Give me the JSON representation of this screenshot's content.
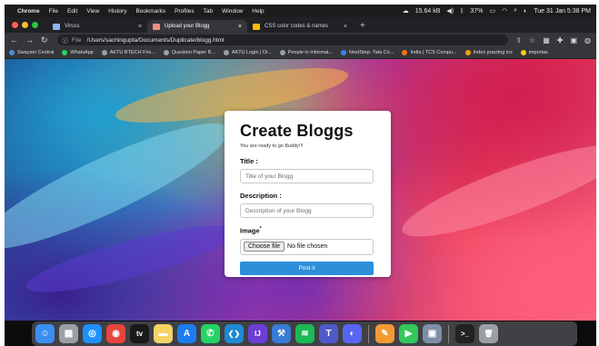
{
  "menubar": {
    "app": "Chrome",
    "menus": [
      "File",
      "Edit",
      "View",
      "History",
      "Bookmarks",
      "Profiles",
      "Tab",
      "Window",
      "Help"
    ],
    "clock": "Tue 31 Jan  5:38 PM",
    "speed": "15.64 kB",
    "battery": "37%"
  },
  "tabs": [
    {
      "title": "Viruss",
      "color": "#8ab4f8"
    },
    {
      "title": "Upload your Blogg",
      "color": "#f28b82"
    },
    {
      "title": "CSS color codes & names",
      "color": "#fbbc04"
    }
  ],
  "addressbar": {
    "scheme_label": "File",
    "url": "/Users/sachingupta/Documents/Duplicate/blogg.html"
  },
  "bookmarks": [
    {
      "label": "Swayam Central",
      "color": "#4a90d9"
    },
    {
      "label": "WhatsApp",
      "color": "#25d366"
    },
    {
      "label": "AKTU BTECH Firs...",
      "color": "#9aa0a6"
    },
    {
      "label": "Question Paper B...",
      "color": "#9aa0a6"
    },
    {
      "label": "AKTU Login | Di...",
      "color": "#9aa0a6"
    },
    {
      "label": "People in Informat...",
      "color": "#9aa0a6"
    },
    {
      "label": "NextStep- Tata Co...",
      "color": "#3b82f6"
    },
    {
      "label": "India | TCS Compu...",
      "color": "#f97316"
    },
    {
      "label": "Index practing tcs",
      "color": "#f59e0b"
    },
    {
      "label": "importas",
      "color": "#facc15"
    }
  ],
  "form": {
    "title": "Create Bloggs",
    "subtitle": "You are ready to go Buddy!!!",
    "title_label": "Title :",
    "title_placeholder": "Title of your Blogg",
    "description_label": "Description :",
    "description_placeholder": "Description of your Blogg",
    "image_label": "Image",
    "image_required_mark": "*",
    "choose_file_label": "Choose file",
    "no_file_text": "No file chosen",
    "submit_label": "Post it"
  },
  "dock": [
    {
      "name": "finder",
      "color": "#3b8ef0",
      "glyph": "☺"
    },
    {
      "name": "launchpad",
      "color": "#9aa0a6",
      "glyph": "▦"
    },
    {
      "name": "safari",
      "color": "#1e90ff",
      "glyph": "◎"
    },
    {
      "name": "chrome",
      "color": "#e8453c",
      "glyph": "◉"
    },
    {
      "name": "apple-tv",
      "color": "#1a1a1a",
      "glyph": "tv"
    },
    {
      "name": "notes",
      "color": "#f6d365",
      "glyph": "▬"
    },
    {
      "name": "app-store",
      "color": "#1d7cf2",
      "glyph": "A"
    },
    {
      "name": "whatsapp",
      "color": "#25d366",
      "glyph": "✆"
    },
    {
      "name": "vscode",
      "color": "#1f8ad2",
      "glyph": "❮❯"
    },
    {
      "name": "intellij",
      "color": "#6b3fd6",
      "glyph": "IJ"
    },
    {
      "name": "xcode",
      "color": "#3a7bd5",
      "glyph": "⚒"
    },
    {
      "name": "spotify",
      "color": "#1db954",
      "glyph": "≋"
    },
    {
      "name": "teams",
      "color": "#5059c9",
      "glyph": "T"
    },
    {
      "name": "discord",
      "color": "#5865f2",
      "glyph": "◐"
    },
    {
      "name": "pages",
      "color": "#f49a32",
      "glyph": "✎"
    },
    {
      "name": "facetime",
      "color": "#34c759",
      "glyph": "▶"
    },
    {
      "name": "preview",
      "color": "#7d8fa6",
      "glyph": "▣"
    },
    {
      "name": "terminal",
      "color": "#222222",
      "glyph": ">_"
    },
    {
      "name": "trash",
      "color": "#9aa0a6",
      "glyph": "🗑"
    }
  ]
}
